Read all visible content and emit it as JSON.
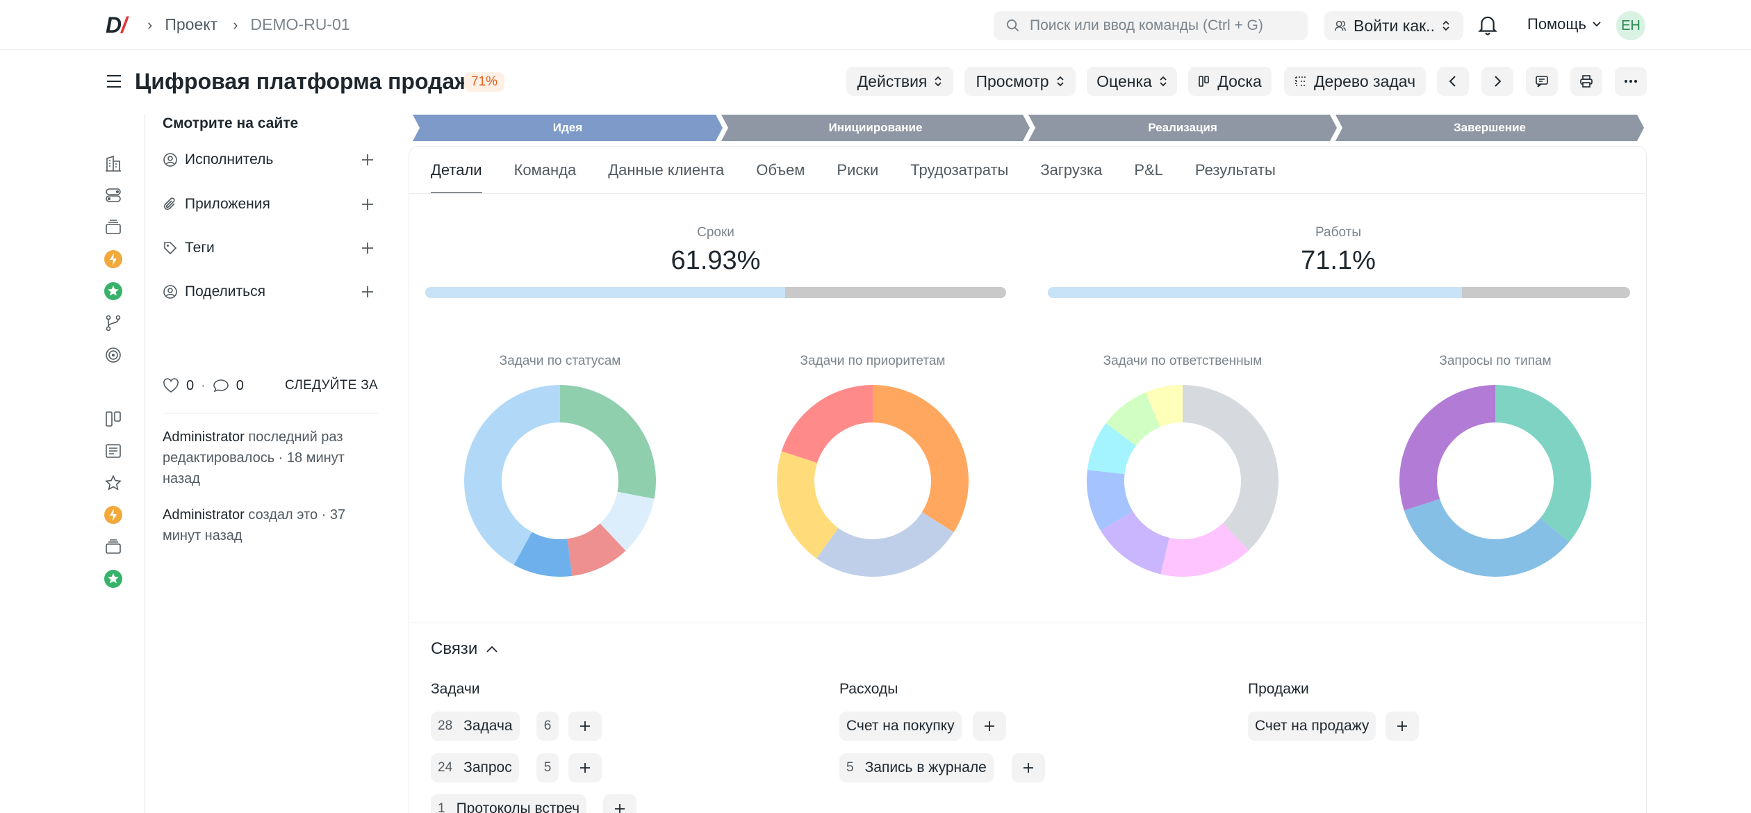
{
  "nav": {
    "logo_main": "D",
    "logo_slash": "/",
    "breadcrumb": [
      "Проект",
      "DEMO-RU-01"
    ],
    "search_placeholder": "Поиск или ввод команды (Ctrl + G)",
    "login_as": "Войти как..",
    "help": "Помощь",
    "avatar": "EH"
  },
  "header": {
    "title": "Цифровая платформа продаж",
    "percent_badge": "71%",
    "buttons": {
      "actions": "Действия",
      "view": "Просмотр",
      "rating": "Оценка",
      "board": "Доска",
      "tree": "Дерево задач"
    }
  },
  "sidebar": {
    "heading": "Смотрите на сайте",
    "items": [
      {
        "label": "Исполнитель",
        "icon": "user-circle-icon"
      },
      {
        "label": "Приложения",
        "icon": "paperclip-icon"
      },
      {
        "label": "Теги",
        "icon": "tag-icon"
      },
      {
        "label": "Поделиться",
        "icon": "share-user-icon"
      }
    ],
    "likes": "0",
    "comments": "0",
    "follow": "СЛЕДУЙТЕ ЗА",
    "activity": [
      {
        "who": "Administrator",
        "text": " последний раз редактировалось · 18 минут назад"
      },
      {
        "who": "Administrator",
        "text": " создал это · 37 минут назад"
      }
    ]
  },
  "stages": [
    "Идея",
    "Инициирование",
    "Реализация",
    "Завершение"
  ],
  "tabs": [
    "Детали",
    "Команда",
    "Данные клиента",
    "Объем",
    "Риски",
    "Трудозатраты",
    "Загрузка",
    "P&L",
    "Результаты"
  ],
  "kpis": [
    {
      "label": "Сроки",
      "value": "61.93%",
      "fraction": 0.6193
    },
    {
      "label": "Работы",
      "value": "71.1%",
      "fraction": 0.711
    }
  ],
  "chart_data": [
    {
      "type": "pie",
      "title": "Задачи по статусам",
      "values": [
        28,
        10,
        10,
        10,
        42
      ],
      "colors": [
        "#8fcfae",
        "#dceefb",
        "#ee9090",
        "#6db0ec",
        "#b2d8f7"
      ]
    },
    {
      "type": "pie",
      "title": "Задачи по приоритетам",
      "values": [
        34,
        26,
        20,
        20
      ],
      "colors": [
        "#ffa75e",
        "#c0cfe9",
        "#ffdb7a",
        "#ff8a8a"
      ]
    },
    {
      "type": "pie",
      "title": "Задачи по ответственным",
      "values": [
        36,
        15,
        12,
        10,
        8,
        8,
        6
      ],
      "colors": [
        "#d6d9de",
        "#fdc4ff",
        "#c9b6ff",
        "#a5c4ff",
        "#a3f4ff",
        "#d1ffc3",
        "#feffb8"
      ]
    },
    {
      "type": "pie",
      "title": "Запросы по типам",
      "values": [
        36,
        34,
        30
      ],
      "colors": [
        "#7ed3c3",
        "#85bfe5",
        "#b27cd6"
      ]
    }
  ],
  "links": {
    "title": "Связи",
    "groups": {
      "tasks": {
        "title": "Задачи",
        "rows": [
          {
            "count": "28",
            "label": "Задача",
            "extra": "6"
          },
          {
            "count": "24",
            "label": "Запрос",
            "extra": "5"
          },
          {
            "count": "1",
            "label": "Протоколы встреч"
          }
        ]
      },
      "expenses": {
        "title": "Расходы",
        "rows": [
          {
            "label": "Счет на покупку"
          },
          {
            "count": "5",
            "label": "Запись в журнале"
          }
        ]
      },
      "sales": {
        "title": "Продажи",
        "rows": [
          {
            "label": "Счет на продажу"
          }
        ]
      }
    }
  }
}
